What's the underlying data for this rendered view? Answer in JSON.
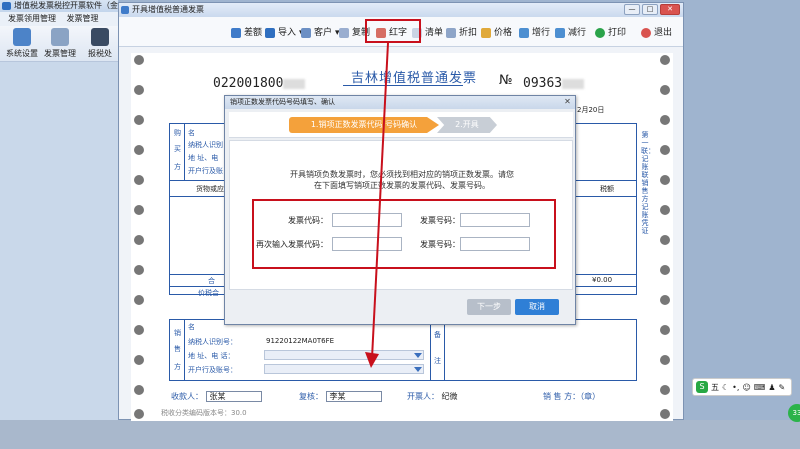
{
  "app": {
    "title": "增值税发票税控开票软件（金税",
    "menu": [
      "发票领用管理",
      "发票管理"
    ],
    "tools": [
      "系统设置",
      "发票管理",
      "报税处"
    ]
  },
  "window": {
    "title": "开具增值税普通发票",
    "controls": [
      "—",
      "□",
      "✕"
    ]
  },
  "toolbar": {
    "items": [
      "差额",
      "导入",
      "客户",
      "复制",
      "红字",
      "清单",
      "折扣",
      "价格",
      "增行",
      "减行",
      "打印",
      "退出"
    ],
    "highlighted": "红字"
  },
  "invoice": {
    "code": "022001800",
    "title": "吉林增值税普通发票",
    "no_label": "№",
    "no": "09363",
    "date_fragment": "2月20日",
    "buyer_side": [
      "购",
      "买",
      "方"
    ],
    "buyer_fields": [
      "名",
      "纳税人识别",
      "地 址、电",
      "开户行及账"
    ],
    "goods_header": "货物或应税",
    "tax_header": "税额",
    "total_label": "合",
    "total_value": "¥0.00",
    "tax_total_label": "价税合",
    "seller_side": [
      "销",
      "售",
      "方"
    ],
    "seller_fields": [
      "名",
      "纳税人识别号：",
      "地 址、电 话：",
      "开户行及账号："
    ],
    "seller_tax_id": "91220122MA0T6FE",
    "remark_side": [
      "备",
      "注"
    ],
    "side_note": "第一联：记账联 销售方记账凭证",
    "footer": {
      "payee_label": "收款人：",
      "payee": "张某",
      "reviewer_label": "复核：",
      "reviewer": "李某",
      "drawer_label": "开票人：",
      "drawer": "纪微",
      "seller_seal_label": "销 售 方：（章）"
    },
    "bottom_note": "税收分类编码版本号：30.0"
  },
  "dialog": {
    "title": "销项正数发票代码号码填写、确认",
    "close": "✕",
    "step1": "1.销项正数发票代码/号码确认",
    "step2": "2.开具",
    "message_line1": "开具销项负数发票时，您必须找到相对应的销项正数发票。请您",
    "message_line2": "在下面填写销项正数发票的发票代码、发票号码。",
    "fields": {
      "code_label": "发票代码：",
      "number_label": "发票号码：",
      "code_confirm_label": "再次输入发票代码：",
      "number_confirm_label": "发票号码：",
      "code_value": "",
      "number_value": "",
      "code_confirm_value": "",
      "number_confirm_value": ""
    },
    "next_button": "下一步",
    "cancel_button": "取消"
  },
  "ime": {
    "logo": "S",
    "mode": "五"
  },
  "tray_badge": "33",
  "colors": {
    "accent_red": "#c8101c",
    "step_orange": "#f4a13b",
    "invoice_blue": "#2a5aa8",
    "primary_button": "#2f7fd6",
    "disabled_button": "#b7bfca"
  }
}
